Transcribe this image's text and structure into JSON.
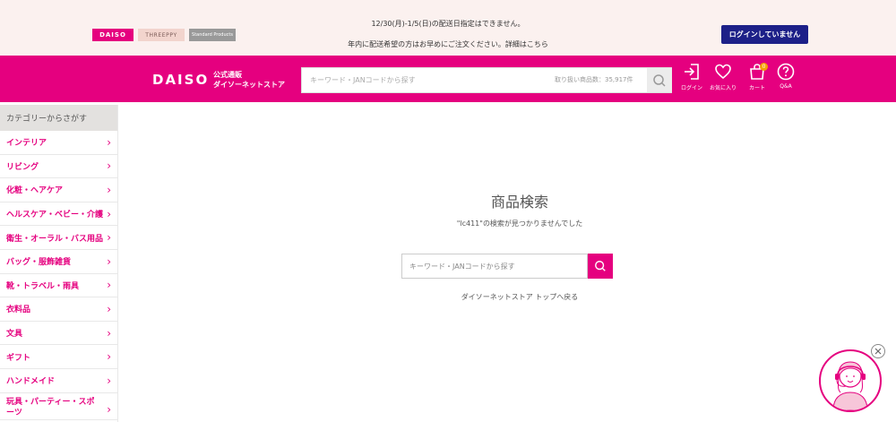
{
  "notice": {
    "line1": "12/30(月)-1/5(日)の配送日指定はできません。",
    "line2": "年内に配送希望の方はお早めにご注文ください。詳細はこちら",
    "login_status": "ログインしていません"
  },
  "brands": {
    "daiso": "DAISO",
    "threeppy": "THREEPPY",
    "standard": "Standard Products"
  },
  "header": {
    "logo": "DAISO",
    "logo_sub1": "公式通販",
    "logo_sub2": "ダイソーネットストア",
    "search_placeholder": "キーワード・JANコードから探す",
    "item_count": "取り扱い商品数：35,917件",
    "nav": {
      "login": "ログイン",
      "favorites": "お気に入り",
      "cart": "カート",
      "cart_count": "0",
      "qa": "Q&A"
    }
  },
  "sidebar": {
    "header": "カテゴリーからさがす",
    "items": [
      {
        "label": "インテリア"
      },
      {
        "label": "リビング"
      },
      {
        "label": "化粧・ヘアケア"
      },
      {
        "label": "ヘルスケア・ベビー・介護"
      },
      {
        "label": "衛生・オーラル・バス用品"
      },
      {
        "label": "バッグ・服飾雑貨"
      },
      {
        "label": "靴・トラベル・雨具"
      },
      {
        "label": "衣料品"
      },
      {
        "label": "文具"
      },
      {
        "label": "ギフト"
      },
      {
        "label": "ハンドメイド"
      },
      {
        "label": "玩具・パーティー・スポーツ"
      }
    ],
    "chevron": "›"
  },
  "main": {
    "title": "商品検索",
    "message": "\"lc411\"の検索が見つかりませんでした",
    "search_placeholder": "キーワード・JANコードから探す",
    "top_link": "ダイソーネットストア トップへ戻る"
  },
  "colors": {
    "brand": "#e5007f",
    "navy": "#1d2088",
    "notice_bg": "#fbf1ef"
  }
}
